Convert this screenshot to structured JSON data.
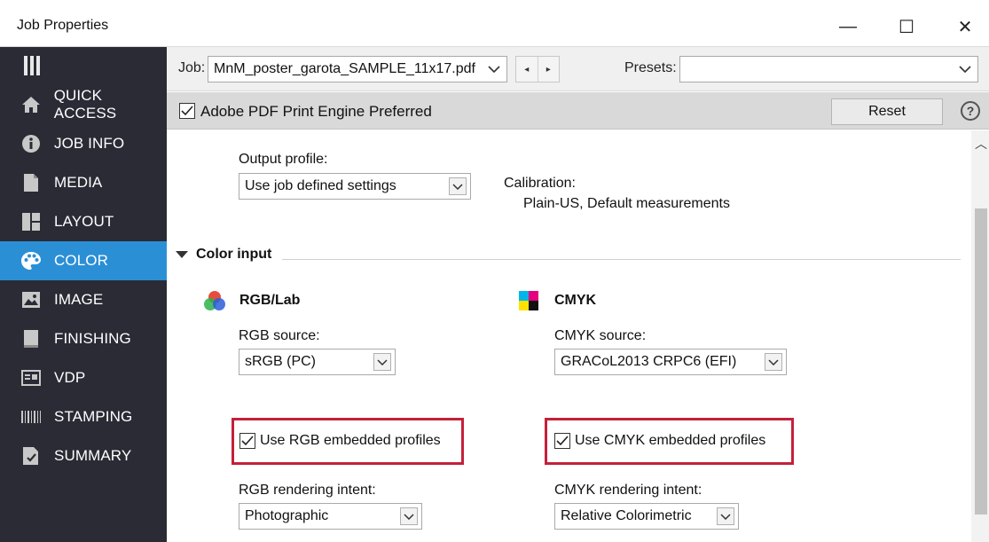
{
  "window": {
    "title": "Job Properties",
    "minimize_glyph": "—",
    "maximize_glyph": "☐",
    "close_glyph": "✕"
  },
  "sidebar": {
    "items": [
      {
        "label": "QUICK ACCESS",
        "icon": "home-icon"
      },
      {
        "label": "JOB INFO",
        "icon": "info-icon"
      },
      {
        "label": "MEDIA",
        "icon": "document-icon"
      },
      {
        "label": "LAYOUT",
        "icon": "layout-icon"
      },
      {
        "label": "COLOR",
        "icon": "palette-icon",
        "active": true
      },
      {
        "label": "IMAGE",
        "icon": "image-icon"
      },
      {
        "label": "FINISHING",
        "icon": "book-icon"
      },
      {
        "label": "VDP",
        "icon": "vdp-icon"
      },
      {
        "label": "STAMPING",
        "icon": "barcode-icon"
      },
      {
        "label": "SUMMARY",
        "icon": "summary-icon"
      }
    ],
    "active_color": "#2b8fd6",
    "bg_color": "#2a2b35"
  },
  "jobbar": {
    "job_label": "Job:",
    "job_value": "MnM_poster_garota_SAMPLE_11x17.pdf",
    "prev_glyph": "◂",
    "next_glyph": "▸",
    "presets_label": "Presets:",
    "presets_value": ""
  },
  "options": {
    "apee_label": "Adobe PDF Print Engine Preferred",
    "apee_checked": true,
    "reset_label": "Reset",
    "help_glyph": "?"
  },
  "content": {
    "output_profile_label": "Output profile:",
    "output_profile_value": "Use job defined settings",
    "calibration_label": "Calibration:",
    "calibration_value": "Plain-US, Default measurements",
    "color_input_title": "Color input",
    "rgb": {
      "title": "RGB/Lab",
      "source_label": "RGB source:",
      "source_value": "sRGB (PC)",
      "embedded_label": "Use RGB embedded profiles",
      "embedded_checked": true,
      "intent_label": "RGB rendering intent:",
      "intent_value": "Photographic"
    },
    "cmyk": {
      "title": "CMYK",
      "source_label": "CMYK source:",
      "source_value": "GRACoL2013 CRPC6 (EFI)",
      "embedded_label": "Use CMYK embedded profiles",
      "embedded_checked": true,
      "intent_label": "CMYK rendering intent:",
      "intent_value": "Relative Colorimetric"
    },
    "highlight_color": "#c4203a"
  }
}
